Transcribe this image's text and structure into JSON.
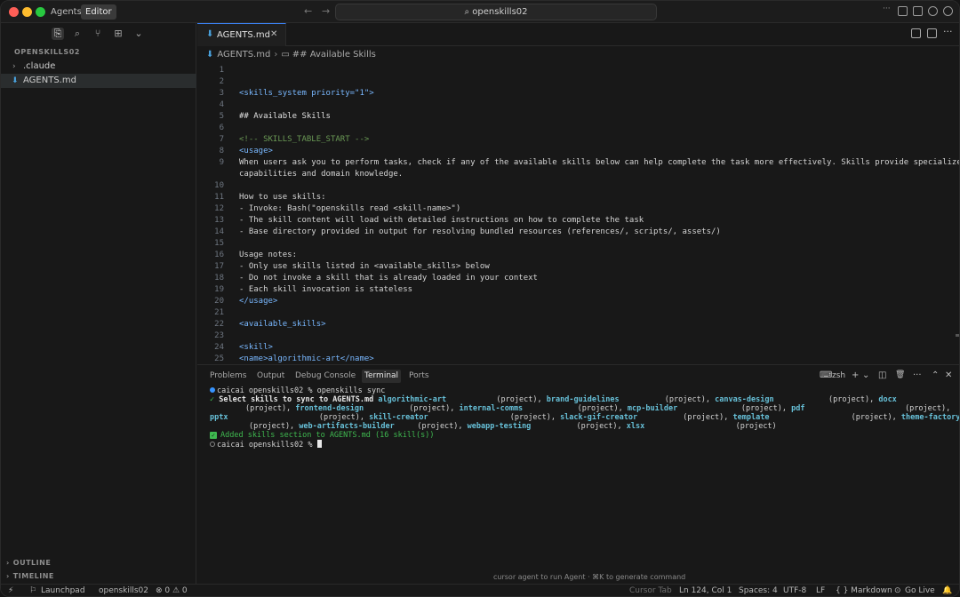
{
  "titlebar": {
    "mode_agents": "Agents",
    "mode_editor": "Editor",
    "back_icon": "←",
    "forward_icon": "→",
    "search_text": "openskills02",
    "search_icon": "⌕"
  },
  "sidebar": {
    "tools": [
      "files-icon",
      "search-icon",
      "source-control-icon",
      "extensions-icon",
      "chevron-down-icon"
    ],
    "header": "OPENSKILLS02",
    "items": [
      {
        "label": ".claude",
        "chevron": "›"
      },
      {
        "label": "AGENTS.md",
        "icon": "⬇"
      }
    ],
    "outline": "OUTLINE",
    "timeline": "TIMELINE",
    "chevron": "›"
  },
  "editor": {
    "tab_label": "AGENTS.md",
    "tab_close": "✕",
    "tab_icon": "⬇",
    "more_icon": "···",
    "breadcrumb": {
      "file": "AGENTS.md",
      "sep": "›",
      "symbol_icon": "▭",
      "symbol": "## Available Skills"
    },
    "lines": [
      {
        "n": "1",
        "t": ""
      },
      {
        "n": "2",
        "t": ""
      },
      {
        "n": "3",
        "t": "<skills_system priority=\"1\">"
      },
      {
        "n": "4",
        "t": ""
      },
      {
        "n": "5",
        "t": "## Available Skills"
      },
      {
        "n": "6",
        "t": ""
      },
      {
        "n": "7",
        "t": "<!-- SKILLS_TABLE_START -->"
      },
      {
        "n": "8",
        "t": "<usage>"
      },
      {
        "n": "9",
        "t": "When users ask you to perform tasks, check if any of the available skills below can help complete the task more effectively. Skills provide specialized"
      },
      {
        "n": "",
        "t": "capabilities and domain knowledge."
      },
      {
        "n": "10",
        "t": ""
      },
      {
        "n": "11",
        "t": "How to use skills:"
      },
      {
        "n": "12",
        "t": "- Invoke: Bash(\"openskills read <skill-name>\")"
      },
      {
        "n": "13",
        "t": "- The skill content will load with detailed instructions on how to complete the task"
      },
      {
        "n": "14",
        "t": "- Base directory provided in output for resolving bundled resources (references/, scripts/, assets/)"
      },
      {
        "n": "15",
        "t": ""
      },
      {
        "n": "16",
        "t": "Usage notes:"
      },
      {
        "n": "17",
        "t": "- Only use skills listed in <available_skills> below"
      },
      {
        "n": "18",
        "t": "- Do not invoke a skill that is already loaded in your context"
      },
      {
        "n": "19",
        "t": "- Each skill invocation is stateless"
      },
      {
        "n": "20",
        "t": "</usage>"
      },
      {
        "n": "21",
        "t": ""
      },
      {
        "n": "22",
        "t": "<available_skills>"
      },
      {
        "n": "23",
        "t": ""
      },
      {
        "n": "24",
        "t": "<skill>"
      },
      {
        "n": "25",
        "t": "<name>algorithmic-art</name>"
      }
    ]
  },
  "panel": {
    "tabs": [
      "Problems",
      "Output",
      "Debug Console",
      "Terminal",
      "Ports"
    ],
    "active_tab": "Terminal",
    "shell_label": "zsh",
    "shell_icon": "⌨",
    "add_icon": "+",
    "caret_icon": "⌄",
    "split_icon": "◫",
    "trash_icon": "🗑",
    "more_icon": "···",
    "close_icon": "✕",
    "terminal": {
      "prompt1": "caicai openskills02 % openskills sync",
      "check": "✓",
      "select_prefix": "Select skills to sync to AGENTS.md",
      "row1": [
        {
          "name": "algorithmic-art",
          "tag": "(project),"
        },
        {
          "name": "brand-guidelines",
          "tag": "(project),"
        },
        {
          "name": "canvas-design",
          "tag": "(project),"
        },
        {
          "name": "docx",
          "tag": ""
        }
      ],
      "row2": [
        {
          "name": "",
          "tag": "(project),"
        },
        {
          "name": "frontend-design",
          "tag": "(project),"
        },
        {
          "name": "internal-comms",
          "tag": "(project),"
        },
        {
          "name": "mcp-builder",
          "tag": "(project),"
        },
        {
          "name": "pdf",
          "tag": "(project),"
        }
      ],
      "row3": [
        {
          "name": "pptx",
          "tag": "(project),"
        },
        {
          "name": "skill-creator",
          "tag": "(project),"
        },
        {
          "name": "slack-gif-creator",
          "tag": "(project),"
        },
        {
          "name": "template",
          "tag": "(project),"
        },
        {
          "name": "theme-factory",
          "tag": ""
        }
      ],
      "row4": [
        {
          "name": "",
          "tag": "(project),"
        },
        {
          "name": "web-artifacts-builder",
          "tag": "(project),"
        },
        {
          "name": "webapp-testing",
          "tag": "(project),"
        },
        {
          "name": "xlsx",
          "tag": "(project)"
        }
      ],
      "added": "Added skills section to AGENTS.md (16 skill(s))",
      "prompt2": "caicai openskills02 % "
    },
    "hint": "cursor  agent to run Agent · ⌘K to generate command"
  },
  "statusbar": {
    "launchpad": "Launchpad",
    "branch": "openskills02",
    "problems": "⊗ 0 ⚠ 0",
    "cursor_tab": "Cursor Tab",
    "position": "Ln 124, Col 1",
    "spaces": "Spaces: 4",
    "encoding": "UTF-8",
    "eol": "LF",
    "language": "{ } Markdown",
    "golive": "Go Live"
  }
}
